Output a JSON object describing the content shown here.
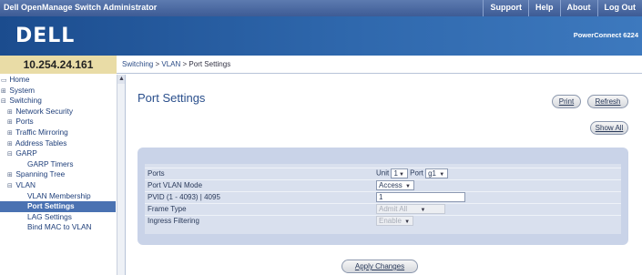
{
  "topbar": {
    "app_title": "Dell OpenManage Switch Administrator",
    "links": [
      "Support",
      "Help",
      "About",
      "Log Out"
    ]
  },
  "brand": {
    "logo": "DELL",
    "model": "PowerConnect 6224"
  },
  "ip": "10.254.24.161",
  "breadcrumb": {
    "part1": "Switching",
    "sep1": " > ",
    "part2": "VLAN",
    "sep2": " > ",
    "part3": "Port Settings"
  },
  "sidebar": {
    "items": [
      {
        "icon": "▭",
        "label": "Home"
      },
      {
        "icon": "⊞",
        "label": "System"
      },
      {
        "icon": "⊟",
        "label": "Switching"
      },
      {
        "icon": "⊞",
        "label": "Network Security"
      },
      {
        "icon": "⊞",
        "label": "Ports"
      },
      {
        "icon": "⊞",
        "label": "Traffic Mirroring"
      },
      {
        "icon": "⊞",
        "label": "Address Tables"
      },
      {
        "icon": "⊟",
        "label": "GARP"
      },
      {
        "icon": "",
        "label": "GARP Timers"
      },
      {
        "icon": "⊞",
        "label": "Spanning Tree"
      },
      {
        "icon": "⊟",
        "label": "VLAN"
      },
      {
        "icon": "",
        "label": "VLAN Membership"
      },
      {
        "icon": "",
        "label": "Port Settings"
      },
      {
        "icon": "",
        "label": "LAG Settings"
      },
      {
        "icon": "",
        "label": "Bind MAC to VLAN"
      }
    ]
  },
  "main": {
    "title": "Port Settings",
    "buttons": {
      "print": "Print",
      "refresh": "Refresh",
      "show_all": "Show All",
      "apply": "Apply Changes"
    },
    "form": {
      "ports_label": "Ports",
      "unit_label": "Unit",
      "unit_value": "1",
      "port_label": "Port",
      "port_value": "g1",
      "mode_label": "Port VLAN Mode",
      "mode_value": "Access",
      "pvid_label": "PVID (1 - 4093) | 4095",
      "pvid_value": "1",
      "frame_label": "Frame Type",
      "frame_value": "Admit All",
      "ingress_label": "Ingress Filtering",
      "ingress_value": "Enable"
    }
  }
}
